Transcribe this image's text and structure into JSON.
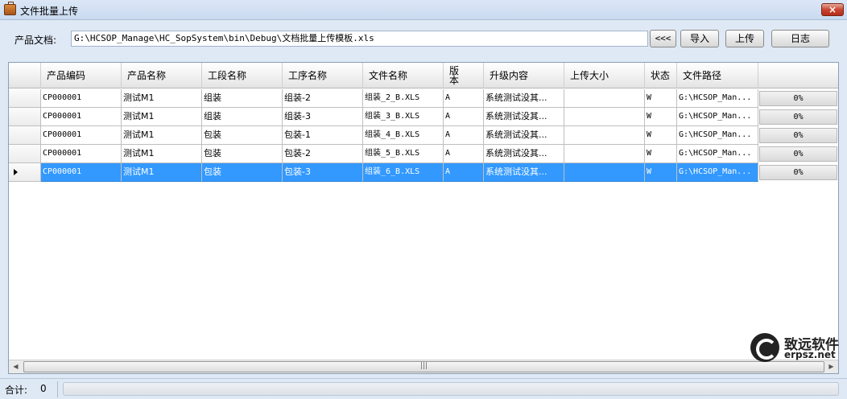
{
  "window": {
    "title": "文件批量上传",
    "close_label": "×"
  },
  "toolbar": {
    "doc_label": "产品文档:",
    "doc_path": "G:\\HCSOP_Manage\\HC_SopSystem\\bin\\Debug\\文档批量上传模板.xls",
    "prev_label": "<<<",
    "import_label": "导入",
    "upload_label": "上传",
    "log_label": "日志"
  },
  "grid": {
    "columns": {
      "product_code": "产品编码",
      "product_name": "产品名称",
      "section_name": "工段名称",
      "process_name": "工序名称",
      "file_name": "文件名称",
      "version": "版本",
      "upgrade": "升级内容",
      "upload_size": "上传大小",
      "status": "状态",
      "file_path": "文件路径"
    },
    "rows": [
      {
        "product_code": "CP000001",
        "product_name": "测试M1",
        "section_name": "组装",
        "process_name": "组装-2",
        "file_name": "组装_2_B.XLS",
        "version": "A",
        "upgrade": "系统测试没其...",
        "upload_size": "",
        "status": "W",
        "file_path": "G:\\HCSOP_Man...",
        "progress": "0%"
      },
      {
        "product_code": "CP000001",
        "product_name": "测试M1",
        "section_name": "组装",
        "process_name": "组装-3",
        "file_name": "组装_3_B.XLS",
        "version": "A",
        "upgrade": "系统测试没其...",
        "upload_size": "",
        "status": "W",
        "file_path": "G:\\HCSOP_Man...",
        "progress": "0%"
      },
      {
        "product_code": "CP000001",
        "product_name": "测试M1",
        "section_name": "包装",
        "process_name": "包装-1",
        "file_name": "组装_4_B.XLS",
        "version": "A",
        "upgrade": "系统测试没其...",
        "upload_size": "",
        "status": "W",
        "file_path": "G:\\HCSOP_Man...",
        "progress": "0%"
      },
      {
        "product_code": "CP000001",
        "product_name": "测试M1",
        "section_name": "包装",
        "process_name": "包装-2",
        "file_name": "组装_5_B.XLS",
        "version": "A",
        "upgrade": "系统测试没其...",
        "upload_size": "",
        "status": "W",
        "file_path": "G:\\HCSOP_Man...",
        "progress": "0%"
      },
      {
        "product_code": "CP000001",
        "product_name": "测试M1",
        "section_name": "包装",
        "process_name": "包装-3",
        "file_name": "组装_6_B.XLS",
        "version": "A",
        "upgrade": "系统测试没其...",
        "upload_size": "",
        "status": "W",
        "file_path": "G:\\HCSOP_Man...",
        "progress": "0%"
      }
    ],
    "selected_row": 4,
    "scroll_grip": "|||"
  },
  "watermark": {
    "name": "致远软件",
    "domain": "erpsz.net"
  },
  "statusbar": {
    "total_label": "合计:",
    "total_value": "0"
  },
  "icons": {
    "app": "briefcase-icon",
    "close": "close-icon",
    "scroll_left": "arrow-left-icon",
    "scroll_right": "arrow-right-icon",
    "row_pointer": "triangle-right-icon"
  },
  "colors": {
    "selection": "#3399ff",
    "close_button": "#c8452e"
  }
}
